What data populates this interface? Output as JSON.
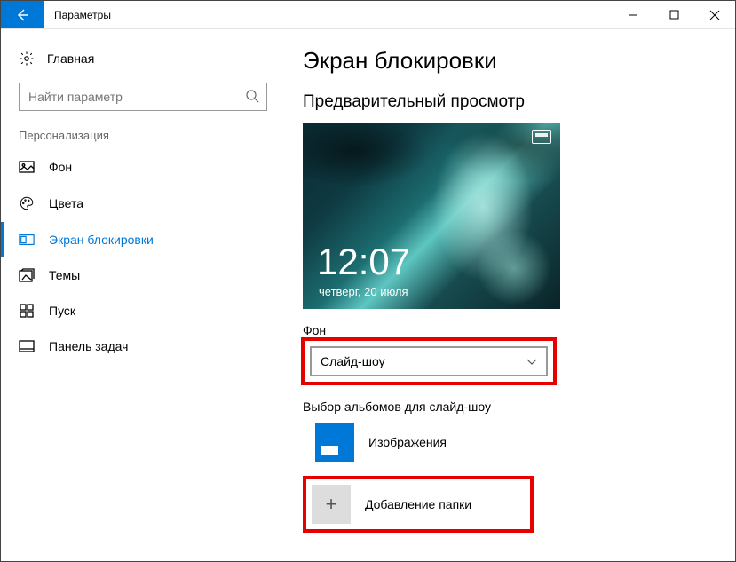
{
  "window": {
    "title": "Параметры"
  },
  "sidebar": {
    "home": "Главная",
    "search_placeholder": "Найти параметр",
    "section": "Персонализация",
    "items": [
      {
        "label": "Фон"
      },
      {
        "label": "Цвета"
      },
      {
        "label": "Экран блокировки"
      },
      {
        "label": "Темы"
      },
      {
        "label": "Пуск"
      },
      {
        "label": "Панель задач"
      }
    ]
  },
  "main": {
    "title": "Экран блокировки",
    "preview_label": "Предварительный просмотр",
    "preview": {
      "time": "12:07",
      "date": "четверг, 20 июля"
    },
    "background_label": "Фон",
    "background_value": "Слайд-шоу",
    "albums_label": "Выбор альбомов для слайд-шоу",
    "album_name": "Изображения",
    "add_folder_label": "Добавление папки"
  }
}
